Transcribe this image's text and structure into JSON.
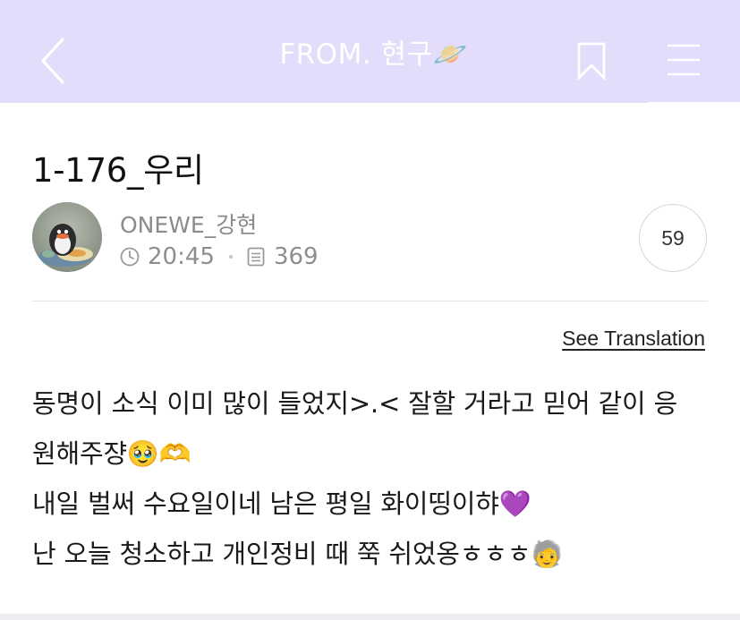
{
  "header": {
    "title": "FROM. 현구🪐",
    "back_icon": "chevron-left-icon",
    "bookmark_icon": "bookmark-icon",
    "menu_icon": "hamburger-menu-icon",
    "background_color": "#e3dcfa"
  },
  "post": {
    "title": "1-176_우리",
    "author": {
      "name": "ONEWE_강현",
      "avatar": "penguin-avatar"
    },
    "time": "20:45",
    "views": "369",
    "comment_count": "59",
    "see_translation": "See Translation",
    "body_lines": [
      "동명이 소식 이미 많이 들었지>.< 잘할 거라고 믿어 같이 응",
      "원해주쟝🥹🫶",
      "내일 벌써 수요일이네 남은 평일 화이띵이햐💜",
      "난 오늘 청소하고 개인정비 때 쭉 쉬었옹ㅎㅎㅎ🧓"
    ]
  }
}
